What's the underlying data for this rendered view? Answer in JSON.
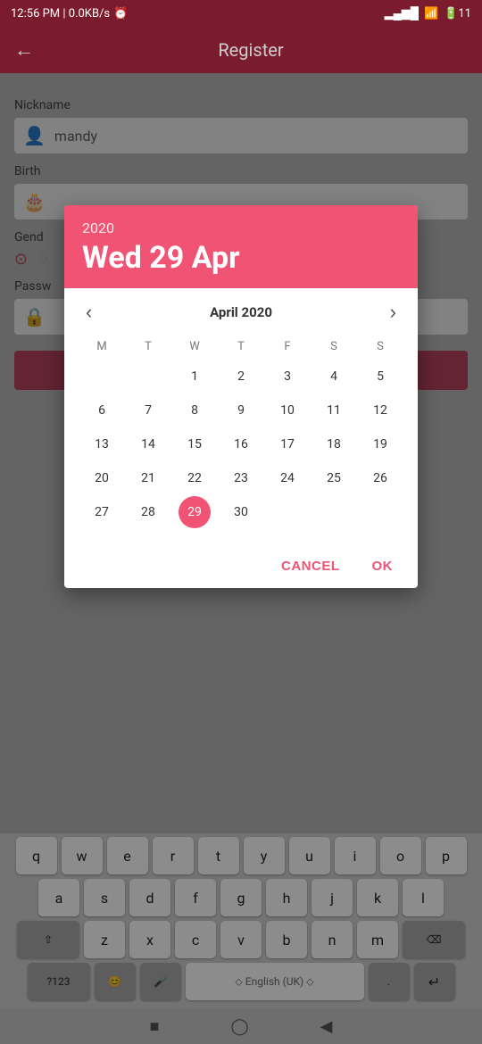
{
  "statusBar": {
    "time": "12:56 PM | 0.0KB/s",
    "alarm": "⏰",
    "battery": "11"
  },
  "appBar": {
    "title": "Register",
    "backIcon": "←"
  },
  "form": {
    "nicknameLabel": "Nickname",
    "nicknamePlaceholder": "mandy",
    "birthLabel": "Birth",
    "genderLabel": "Gend",
    "passwordLabel": "Passw"
  },
  "datePicker": {
    "year": "2020",
    "dateDisplay": "Wed 29 Apr",
    "monthTitle": "April 2020",
    "weekDays": [
      "M",
      "T",
      "W",
      "T",
      "F",
      "S",
      "S"
    ],
    "weeks": [
      [
        "",
        "",
        "1",
        "2",
        "3",
        "4",
        "5"
      ],
      [
        "6",
        "7",
        "8",
        "9",
        "10",
        "11",
        "12"
      ],
      [
        "13",
        "14",
        "15",
        "16",
        "17",
        "18",
        "19"
      ],
      [
        "20",
        "21",
        "22",
        "23",
        "24",
        "25",
        "26"
      ],
      [
        "27",
        "28",
        "29",
        "30",
        "",
        "",
        ""
      ]
    ],
    "selectedDay": "29",
    "cancelLabel": "CANCEL",
    "okLabel": "OK"
  },
  "keyboard": {
    "row1": [
      "q",
      "w",
      "e",
      "r",
      "t",
      "y",
      "u",
      "i",
      "o",
      "p"
    ],
    "row2": [
      "a",
      "s",
      "d",
      "f",
      "g",
      "h",
      "j",
      "k",
      "l"
    ],
    "row3": [
      "z",
      "x",
      "c",
      "v",
      "b",
      "n",
      "m"
    ],
    "spaceLabel": "English (UK)",
    "symbols": "?123",
    "emoji": "😊",
    "mic": "🎤",
    "delete": "⌫",
    "shift": "⇧",
    "enter": "↵"
  },
  "navBar": {
    "squareIcon": "■",
    "circleIcon": "◯",
    "triangleIcon": "◀"
  }
}
